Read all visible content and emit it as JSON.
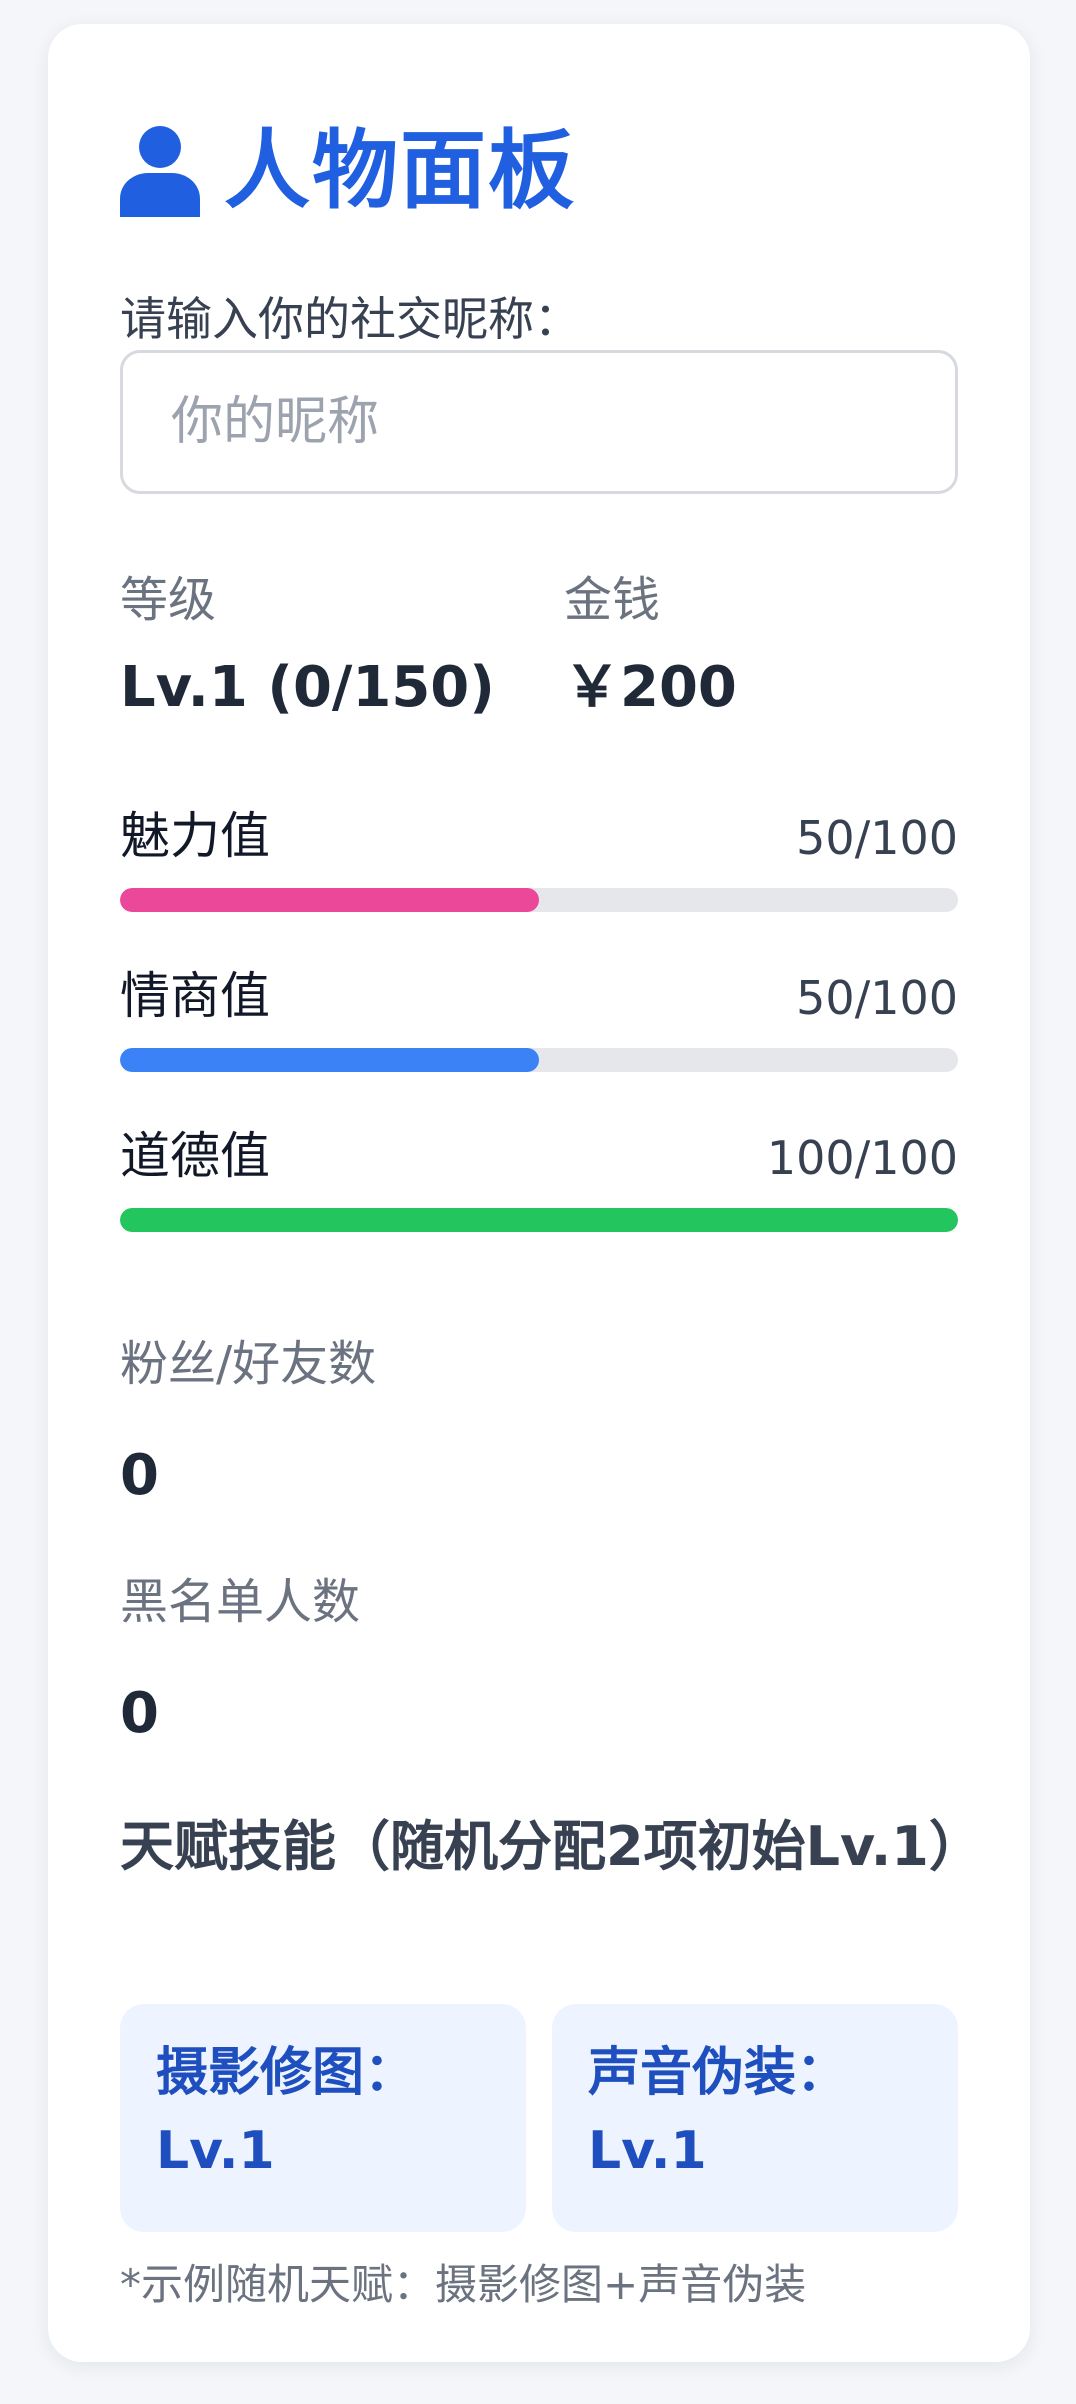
{
  "panel": {
    "title": "人物面板",
    "title_icon": "user-icon"
  },
  "nickname": {
    "label": "请输入你的社交昵称：",
    "placeholder": "你的昵称",
    "value": ""
  },
  "stats": {
    "level": {
      "caption": "等级",
      "value": "Lv.1 (0/150)"
    },
    "money": {
      "caption": "金钱",
      "value": "￥200"
    }
  },
  "bars": [
    {
      "name": "魅力值",
      "text": "50/100",
      "fraction": 0.5,
      "color": "#ec4899"
    },
    {
      "name": "情商值",
      "text": "50/100",
      "fraction": 0.5,
      "color": "#3b82f6"
    },
    {
      "name": "道德值",
      "text": "100/100",
      "fraction": 1.0,
      "color": "#22c55e"
    }
  ],
  "counts": {
    "fans": {
      "label": "粉丝/好友数",
      "value": "0"
    },
    "blacklist": {
      "label": "黑名单人数",
      "value": "0"
    }
  },
  "talents": {
    "heading": "天赋技能（随机分配2项初始Lv.1）",
    "skills": [
      {
        "name": "摄影修图：",
        "level": "Lv.1"
      },
      {
        "name": "声音伪装：",
        "level": "Lv.1"
      }
    ],
    "note": "*示例随机天赋：摄影修图+声音伪装"
  },
  "colors": {
    "accent": "#1f5fe0",
    "skill_bg": "#eef4ff"
  }
}
